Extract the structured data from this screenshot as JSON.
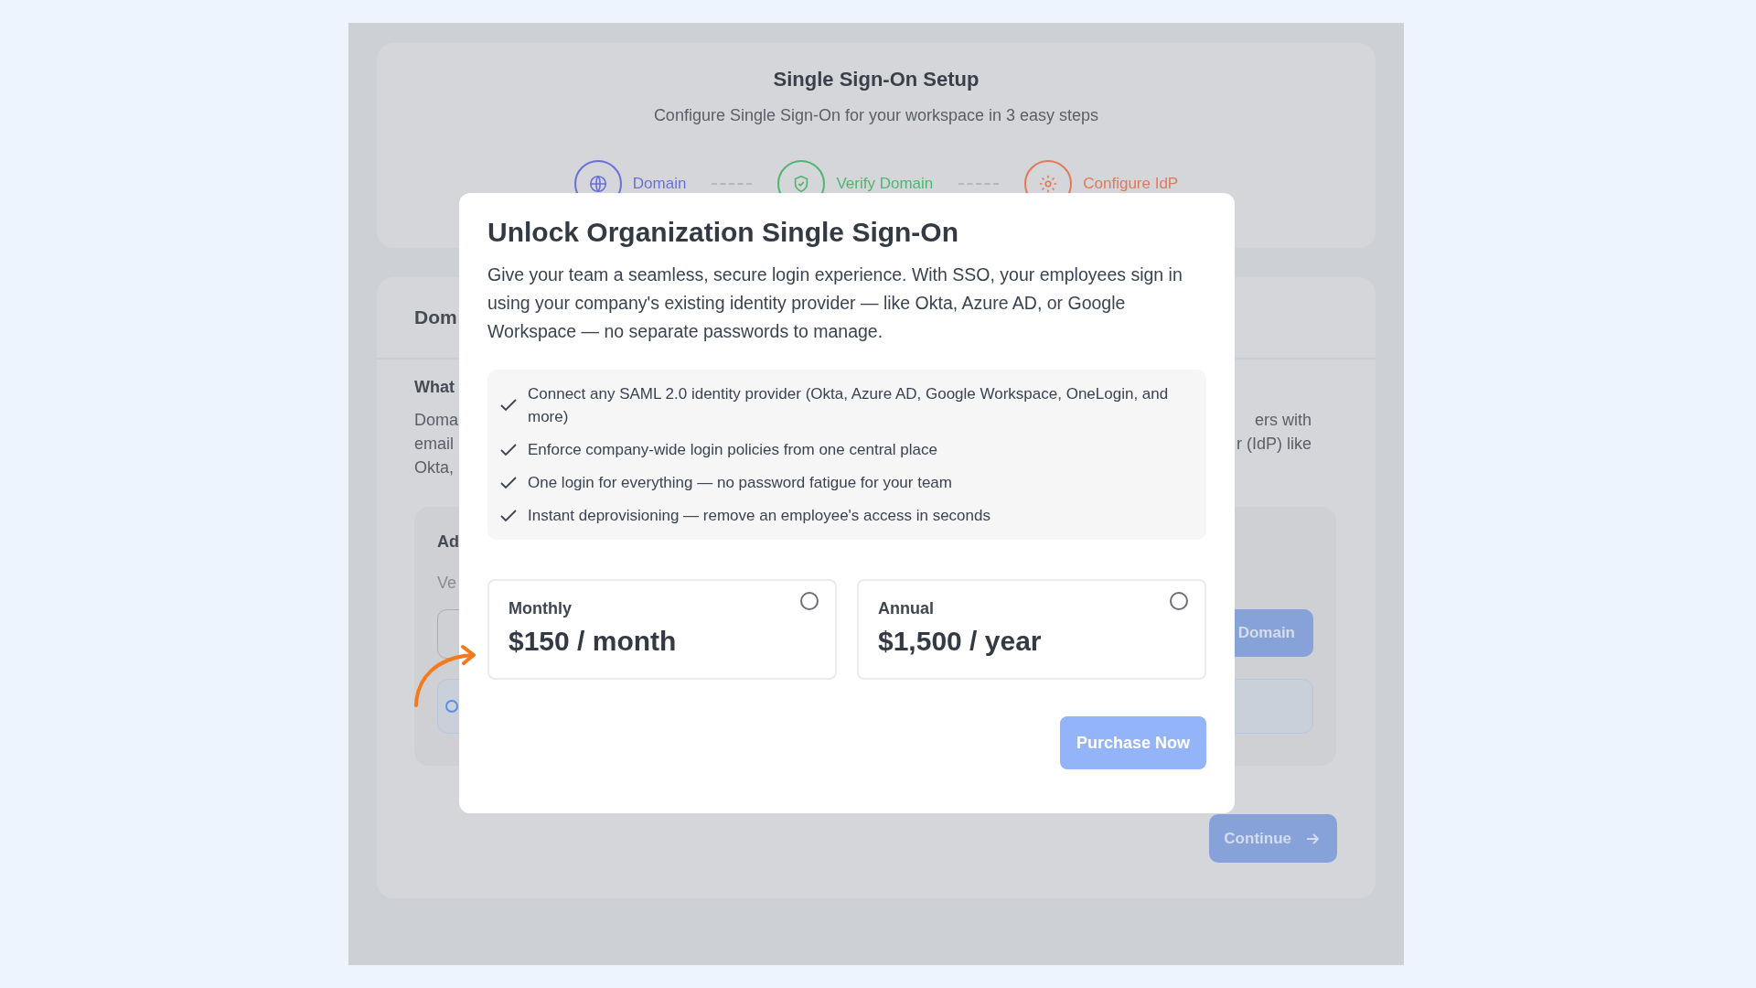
{
  "setup": {
    "title": "Single Sign-On Setup",
    "subtitle": "Configure Single Sign-On for your workspace in 3 easy steps",
    "steps": [
      {
        "label": "Domain",
        "color": "#6b6fd8"
      },
      {
        "label": "Verify Domain",
        "color": "#4fb56f"
      },
      {
        "label": "Configure IdP",
        "color": "#e0795c"
      }
    ]
  },
  "domain_card": {
    "heading": "Dom",
    "section_title": "What",
    "paragraph_lines": [
      {
        "left": "Doma",
        "right": "ers with"
      },
      {
        "left": "email",
        "right": "r (IdP) like"
      },
      {
        "left": "Okta,"
      }
    ],
    "add_box": {
      "title": "Ad",
      "hint": "Ve",
      "button": "Domain"
    },
    "continue_button": "Continue"
  },
  "modal": {
    "title": "Unlock Organization Single Sign-On",
    "description": "Give your team a seamless, secure login experience. With SSO, your employees sign in using your company's existing identity provider — like Okta, Azure AD, or Google Workspace — no separate passwords to manage.",
    "features": [
      "Connect any SAML 2.0 identity provider (Okta, Azure AD, Google Workspace, OneLogin, and more)",
      "Enforce company-wide login policies from one central place",
      "One login for everything — no password fatigue for your team",
      "Instant deprovisioning — remove an employee's access in seconds"
    ],
    "plans": [
      {
        "name": "Monthly",
        "price": "$150 / month",
        "selected": false
      },
      {
        "name": "Annual",
        "price": "$1,500 / year",
        "selected": false
      }
    ],
    "purchase_button": {
      "label": "Purchase Now",
      "disabled": true
    }
  }
}
